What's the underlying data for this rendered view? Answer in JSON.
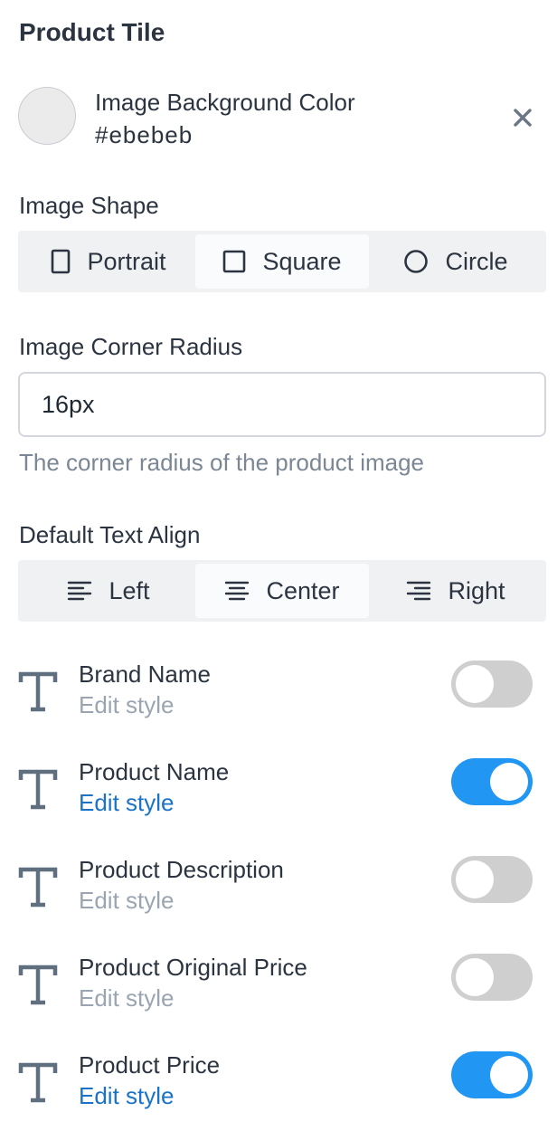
{
  "header": {
    "title": "Product Tile"
  },
  "background_color": {
    "label": "Image Background Color",
    "value": "#ebebeb",
    "swatch": "#ebebeb",
    "clear_icon": "close-icon"
  },
  "image_shape": {
    "label": "Image Shape",
    "options": [
      {
        "label": "Portrait",
        "icon": "portrait-icon",
        "active": false
      },
      {
        "label": "Square",
        "icon": "square-icon",
        "active": true
      },
      {
        "label": "Circle",
        "icon": "circle-icon",
        "active": false
      }
    ]
  },
  "corner_radius": {
    "label": "Image Corner Radius",
    "value": "16px",
    "help": "The corner radius of the product image"
  },
  "text_align": {
    "label": "Default Text Align",
    "options": [
      {
        "label": "Left",
        "icon": "align-left-icon",
        "active": false
      },
      {
        "label": "Center",
        "icon": "align-center-icon",
        "active": true
      },
      {
        "label": "Right",
        "icon": "align-right-icon",
        "active": false
      }
    ]
  },
  "text_elements": [
    {
      "name": "Brand Name",
      "edit": "Edit style",
      "enabled": false
    },
    {
      "name": "Product Name",
      "edit": "Edit style",
      "enabled": true
    },
    {
      "name": "Product Description",
      "edit": "Edit style",
      "enabled": false
    },
    {
      "name": "Product Original Price",
      "edit": "Edit style",
      "enabled": false
    },
    {
      "name": "Product Price",
      "edit": "Edit style",
      "enabled": true
    }
  ],
  "colors": {
    "toggle_on": "#2196f3",
    "toggle_off": "#cfcfcf",
    "link_active": "#1a73c7",
    "link_inactive": "#9aa5b1"
  }
}
